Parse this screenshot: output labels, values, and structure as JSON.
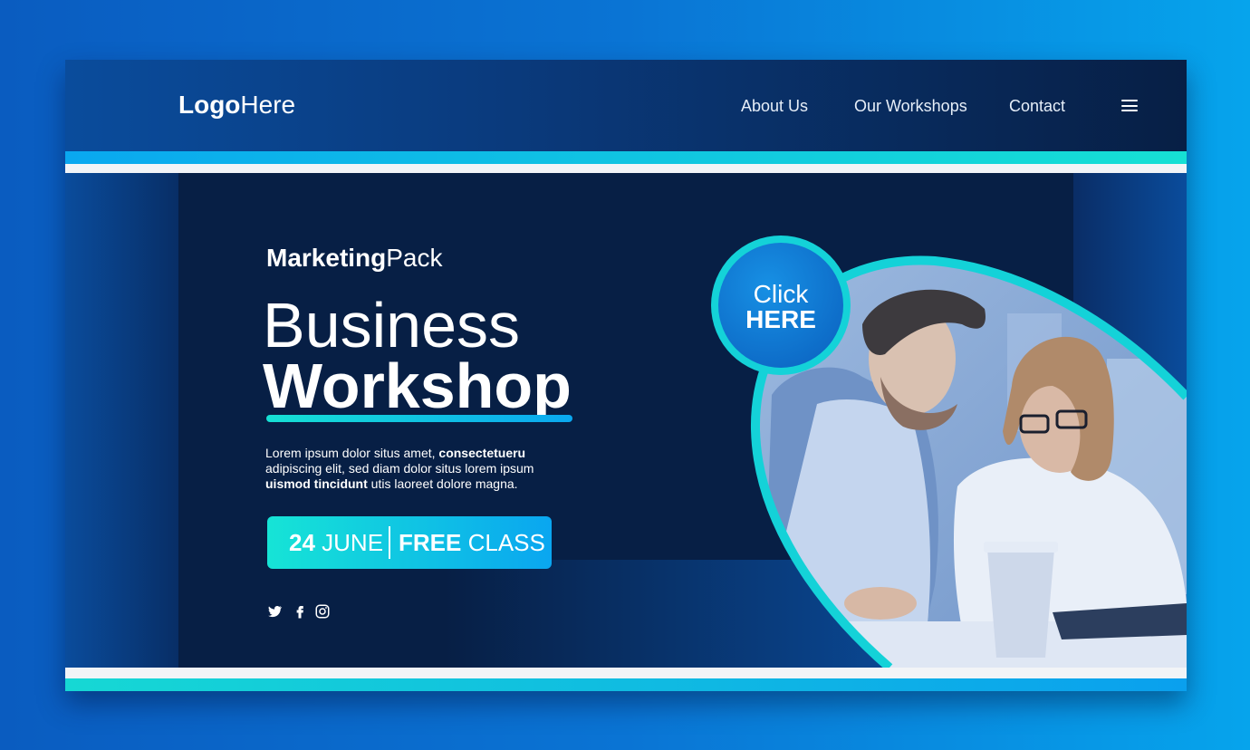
{
  "header": {
    "logo_bold": "Logo",
    "logo_light": "Here",
    "nav": [
      "About Us",
      "Our Workshops",
      "Contact"
    ]
  },
  "hero": {
    "kicker_bold": "Marketing",
    "kicker_light": "Pack",
    "title_line1": "Business",
    "title_line2": "Workshop",
    "desc_part1": "Lorem ipsum dolor situs amet, ",
    "desc_bold1": "consectetueru",
    "desc_part2": " adipiscing elit, sed diam dolor situs lorem ipsum ",
    "desc_bold2": "uismod tincidunt",
    "desc_part3": " utis laoreet dolore magna.",
    "badge_date_bold": "24",
    "badge_date_light": "JUNE",
    "badge_class_bold": "FREE",
    "badge_class_light": "CLASS",
    "click_line1": "Click",
    "click_line2": "HERE"
  },
  "social": [
    "twitter-icon",
    "facebook-icon",
    "instagram-icon"
  ],
  "colors": {
    "navy": "#071f45",
    "blue": "#0a4c9c",
    "cyan": "#16e0d4",
    "sky": "#0aa8f0"
  }
}
